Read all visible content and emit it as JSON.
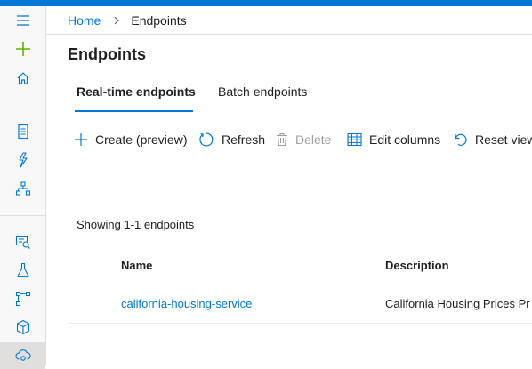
{
  "colors": {
    "accent": "#0078d4",
    "create_icon": "#5db300",
    "text": "#201f1e",
    "disabled": "#a19f9d"
  },
  "leftnav": {
    "items": [
      {
        "icon": "hamburger-icon"
      },
      {
        "icon": "plus-icon"
      },
      {
        "icon": "home-icon"
      },
      {
        "icon": "notebook-icon"
      },
      {
        "icon": "automated-ml-icon"
      },
      {
        "icon": "designer-icon"
      },
      {
        "icon": "datasets-icon"
      },
      {
        "icon": "experiments-icon"
      },
      {
        "icon": "pipelines-icon"
      },
      {
        "icon": "models-icon"
      },
      {
        "icon": "endpoints-icon"
      }
    ]
  },
  "breadcrumb": {
    "home": "Home",
    "current": "Endpoints"
  },
  "page": {
    "title": "Endpoints"
  },
  "tabs": [
    {
      "label": "Real-time endpoints",
      "selected": true
    },
    {
      "label": "Batch endpoints",
      "selected": false
    }
  ],
  "toolbar": {
    "create": "Create (preview)",
    "refresh": "Refresh",
    "delete": "Delete",
    "edit_columns": "Edit columns",
    "reset_view": "Reset view"
  },
  "list": {
    "showing": "Showing 1-1 endpoints",
    "columns": [
      "Name",
      "Description"
    ],
    "rows": [
      {
        "name": "california-housing-service",
        "description": "California Housing Prices Pr"
      }
    ]
  }
}
